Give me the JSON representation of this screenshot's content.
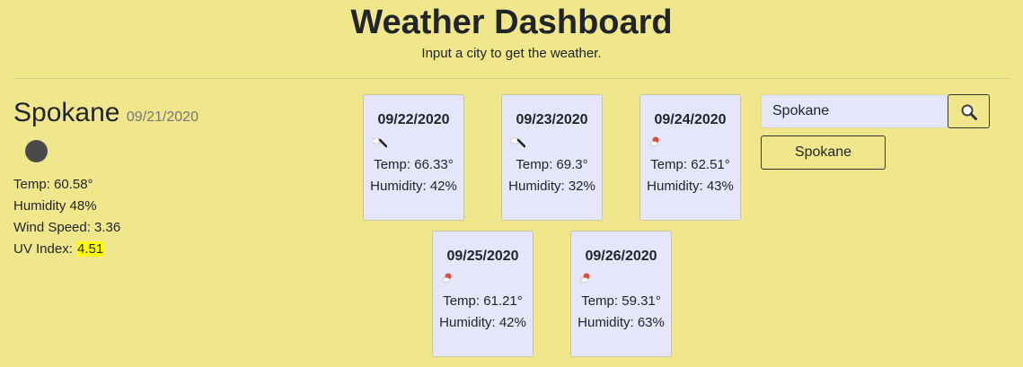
{
  "header": {
    "title": "Weather Dashboard",
    "subtitle": "Input a city to get the weather."
  },
  "current": {
    "city": "Spokane",
    "date": "09/21/2020",
    "icon": "dark-circle-icon",
    "temp": "Temp: 60.58°",
    "humidity": "Humidity 48%",
    "wind": "Wind Speed: 3.36",
    "uv_label": "UV Index: ",
    "uv_value": "4.51",
    "uv_color": "#ffff00"
  },
  "forecast": [
    {
      "date": "09/22/2020",
      "icon": "cloud-rain-icon",
      "temp": "Temp: 66.33°",
      "humidity": "Humidity: 42%"
    },
    {
      "date": "09/23/2020",
      "icon": "cloud-rain-icon",
      "temp": "Temp: 69.3°",
      "humidity": "Humidity: 32%"
    },
    {
      "date": "09/24/2020",
      "icon": "sun-cloud-icon",
      "temp": "Temp: 62.51°",
      "humidity": "Humidity: 43%"
    },
    {
      "date": "09/25/2020",
      "icon": "sun-cloud-icon",
      "temp": "Temp: 61.21°",
      "humidity": "Humidity: 42%"
    },
    {
      "date": "09/26/2020",
      "icon": "sun-cloud-icon",
      "temp": "Temp: 59.31°",
      "humidity": "Humidity: 63%"
    }
  ],
  "search": {
    "value": "Spokane",
    "button_icon": "search-icon"
  },
  "history": [
    "Spokane"
  ],
  "colors": {
    "background": "#f0e68c",
    "card": "#e6e6fa",
    "highlight": "#ffff00"
  }
}
